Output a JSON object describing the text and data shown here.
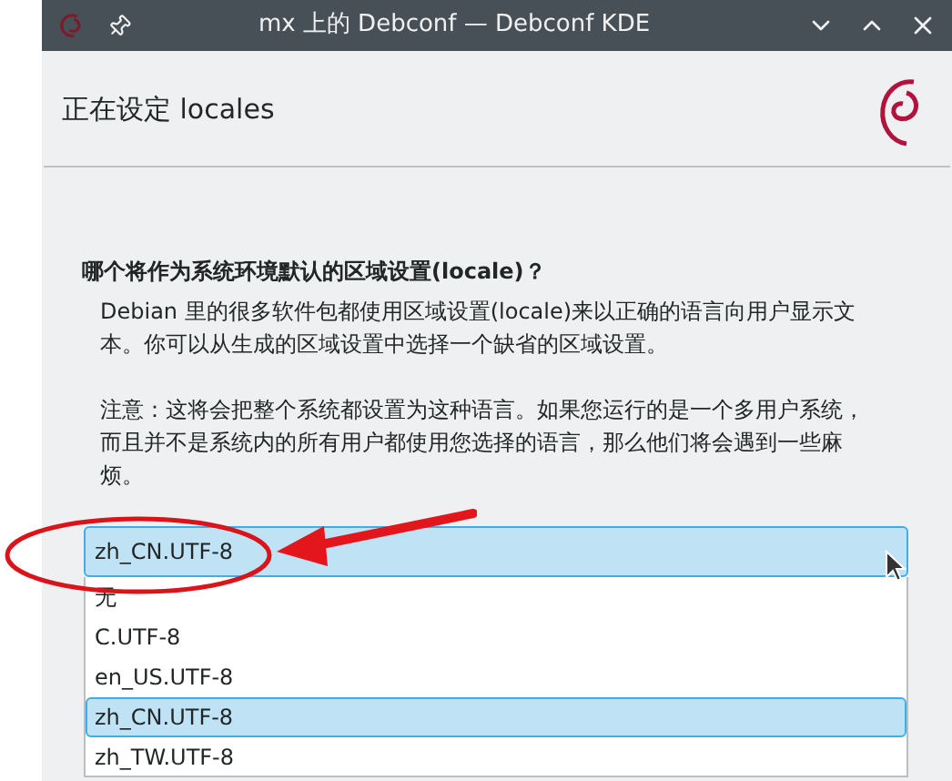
{
  "window": {
    "title": "mx 上的 Debconf — Debconf KDE"
  },
  "header": {
    "title": "正在设定 locales"
  },
  "question": {
    "title": "哪个将作为系统环境默认的区域设置(locale)？",
    "paragraphs": [
      "Debian 里的很多软件包都使用区域设置(locale)来以正确的语言向用户显示文本。你可以从生成的区域设置中选择一个缺省的区域设置。",
      "注意：这将会把整个系统都设置为这种语言。如果您运行的是一个多用户系统，而且并不是系统内的所有用户都使用您选择的语言，那么他们将会遇到一些麻烦。"
    ]
  },
  "dropdown": {
    "value": "zh_CN.UTF-8",
    "expanded": true,
    "options": [
      {
        "label": "无",
        "selected": false
      },
      {
        "label": "C.UTF-8",
        "selected": false
      },
      {
        "label": "en_US.UTF-8",
        "selected": false
      },
      {
        "label": "zh_CN.UTF-8",
        "selected": true
      },
      {
        "label": "zh_TW.UTF-8",
        "selected": false
      }
    ]
  }
}
